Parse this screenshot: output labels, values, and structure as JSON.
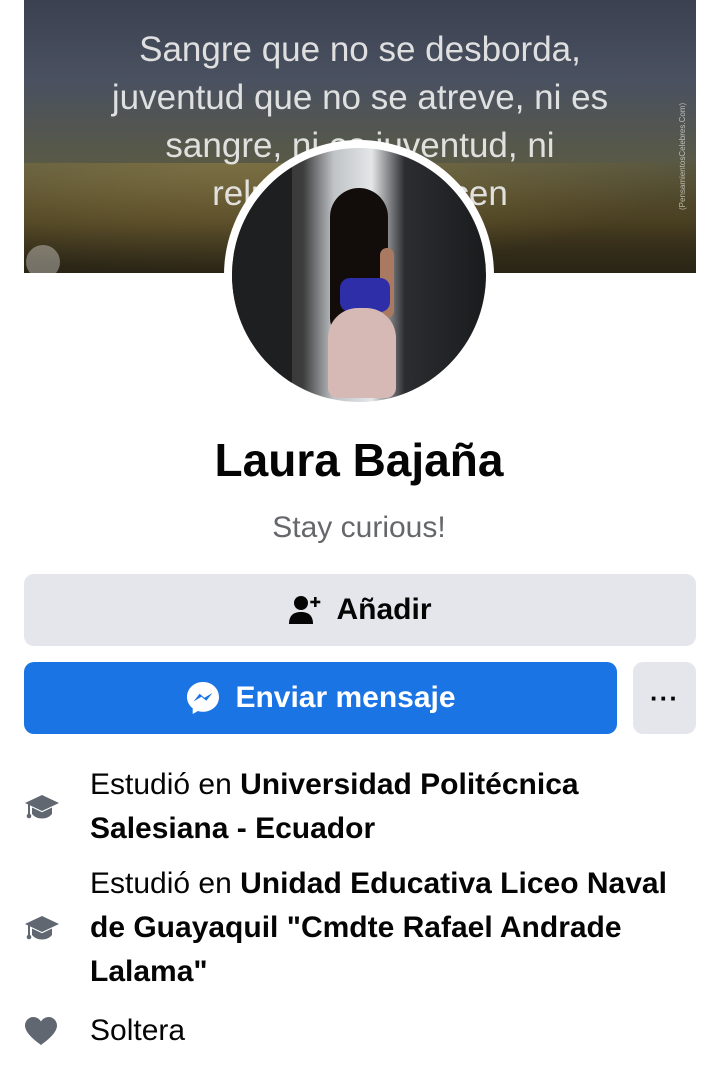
{
  "cover": {
    "quote": "Sangre que no se desborda,\njuventud que no se atreve, ni es\nsangre, ni es juventud, ni\nrelucen, ni florecen",
    "credit": "(PensamientosCelebres.Com)"
  },
  "profile": {
    "name": "Laura Bajaña",
    "bio": "Stay curious!"
  },
  "actions": {
    "add_label": "Añadir",
    "message_label": "Enviar mensaje",
    "more_label": "···",
    "accent_color": "#1b74e4"
  },
  "details": [
    {
      "icon": "graduation-cap-icon",
      "prefix": "Estudió en ",
      "value": "Universidad Politécnica Salesiana - Ecuador"
    },
    {
      "icon": "graduation-cap-icon",
      "prefix": "Estudió en ",
      "value": "Unidad Educativa Liceo Naval de Guayaquil \"Cmdte Rafael Andrade Lalama\""
    },
    {
      "icon": "heart-icon",
      "prefix": "",
      "value": "Soltera"
    }
  ]
}
